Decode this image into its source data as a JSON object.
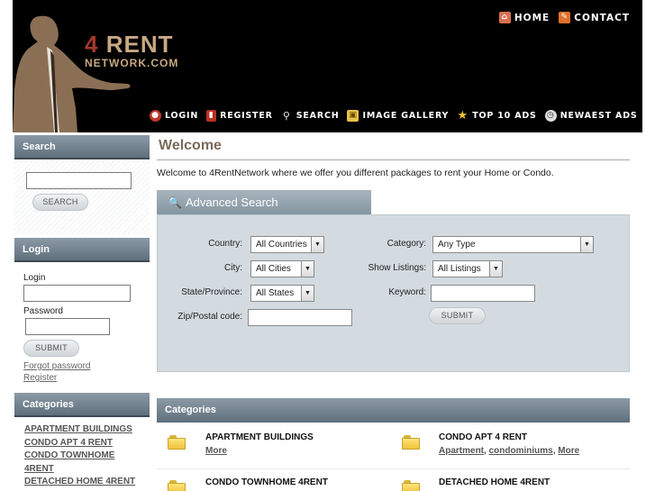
{
  "header": {
    "logo_line1_a": "4",
    "logo_line1_b": "RENT",
    "logo_line2": "NETWORK.COM",
    "top_nav": [
      {
        "label": "HOME",
        "icon": "home-icon"
      },
      {
        "label": "CONTACT",
        "icon": "contact-icon"
      }
    ],
    "main_nav": [
      {
        "label": "LOGIN",
        "icon": "login-icon"
      },
      {
        "label": "REGISTER",
        "icon": "register-icon"
      },
      {
        "label": "SEARCH",
        "icon": "search-icon"
      },
      {
        "label": "IMAGE GALLERY",
        "icon": "gallery-icon"
      },
      {
        "label": "TOP 10 ADS",
        "icon": "star-icon"
      },
      {
        "label": "NEWAEST ADS",
        "icon": "clock-icon"
      }
    ]
  },
  "sidebar": {
    "search": {
      "title": "Search",
      "input_value": "",
      "button": "SEARCH"
    },
    "login": {
      "title": "Login",
      "login_label": "Login",
      "password_label": "Password",
      "button": "SUBMIT",
      "forgot": "Forgot password",
      "register": "Register"
    },
    "categories": {
      "title": "Categories",
      "items": [
        "APARTMENT BUILDINGS",
        "CONDO APT 4 RENT",
        "CONDO TOWNHOME 4RENT",
        "DETACHED HOME 4RENT"
      ]
    }
  },
  "main": {
    "title": "Welcome",
    "intro": "Welcome to 4RentNetwork where we offer you different packages to rent your Home or Condo.",
    "advanced_search": {
      "tab_label": "Advanced Search",
      "country_label": "Country:",
      "country_value": "All Countries",
      "city_label": "City:",
      "city_value": "All Cities",
      "state_label": "State/Province:",
      "state_value": "All States",
      "zip_label": "Zip/Postal code:",
      "category_label": "Category:",
      "category_value": "Any Type",
      "listings_label": "Show Listings:",
      "listings_value": "All Listings",
      "keyword_label": "Keyword:",
      "submit": "SUBMIT"
    },
    "categories": {
      "title": "Categories",
      "items": [
        {
          "title": "APARTMENT BUILDINGS",
          "links": [
            "More"
          ]
        },
        {
          "title": "CONDO APT 4 RENT",
          "links": [
            "Apartment",
            "condominiums",
            "More"
          ]
        },
        {
          "title": "CONDO TOWNHOME 4RENT",
          "links": []
        },
        {
          "title": "DETACHED HOME 4RENT",
          "links": []
        }
      ]
    }
  },
  "colors": {
    "header_bg": "#000000",
    "logo_red": "#a33a2a",
    "logo_tan": "#c8a882",
    "panel_head": "#6f7f8b",
    "search_box": "#d3dbe0",
    "title_brown": "#7a6a5a"
  }
}
